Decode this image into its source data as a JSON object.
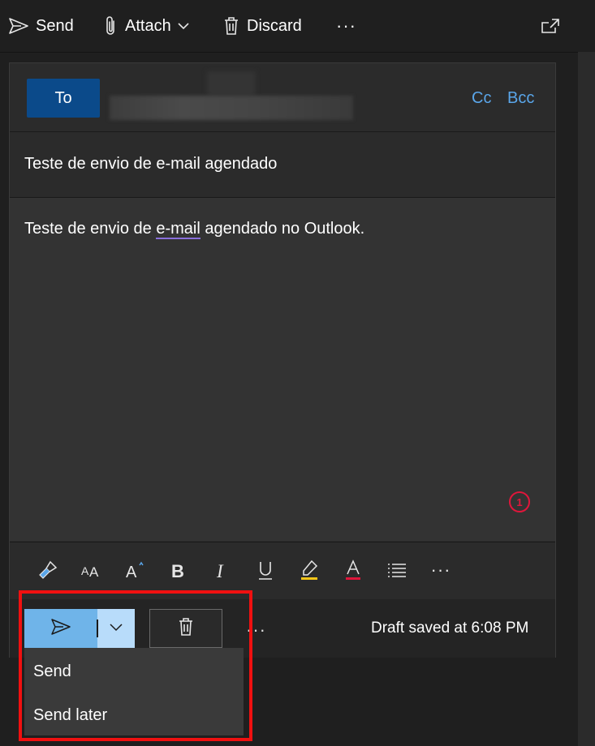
{
  "toolbar": {
    "send_label": "Send",
    "attach_label": "Attach",
    "discard_label": "Discard",
    "more_label": "···",
    "icons": {
      "send": "send-icon",
      "attach": "paperclip-icon",
      "discard": "trash-icon",
      "chevron": "chevron-down-icon",
      "popout": "popout-icon"
    }
  },
  "compose": {
    "to_label": "To",
    "cc_label": "Cc",
    "bcc_label": "Bcc",
    "subject": "Teste de envio de e-mail agendado",
    "body_prefix": "Teste de envio de ",
    "body_misspelled": "e-mail",
    "body_suffix": " agendado no Outlook.",
    "annotation_badge": "1"
  },
  "format_bar": {
    "more_label": "···",
    "icons": [
      "format-painter-icon",
      "font-size-icon",
      "increase-font-icon",
      "bold-icon",
      "italic-icon",
      "underline-icon",
      "highlight-icon",
      "font-color-icon",
      "bullets-icon",
      "more-icon"
    ]
  },
  "bottom_bar": {
    "more_label": "···",
    "draft_status": "Draft saved at 6:08 PM"
  },
  "send_menu": {
    "items": [
      {
        "label": "Send"
      },
      {
        "label": "Send later"
      }
    ]
  },
  "colors": {
    "background": "#1f1f1f",
    "card": "#2b2b2b",
    "accent": "#0b4a8a",
    "link": "#5aa6ea",
    "send_button": "#6fb4e9",
    "highlight_frame": "#f01010",
    "spell_underline": "#8a6fdc",
    "highlight_marker": "#f5c518",
    "font_color_marker": "#e0163b"
  }
}
